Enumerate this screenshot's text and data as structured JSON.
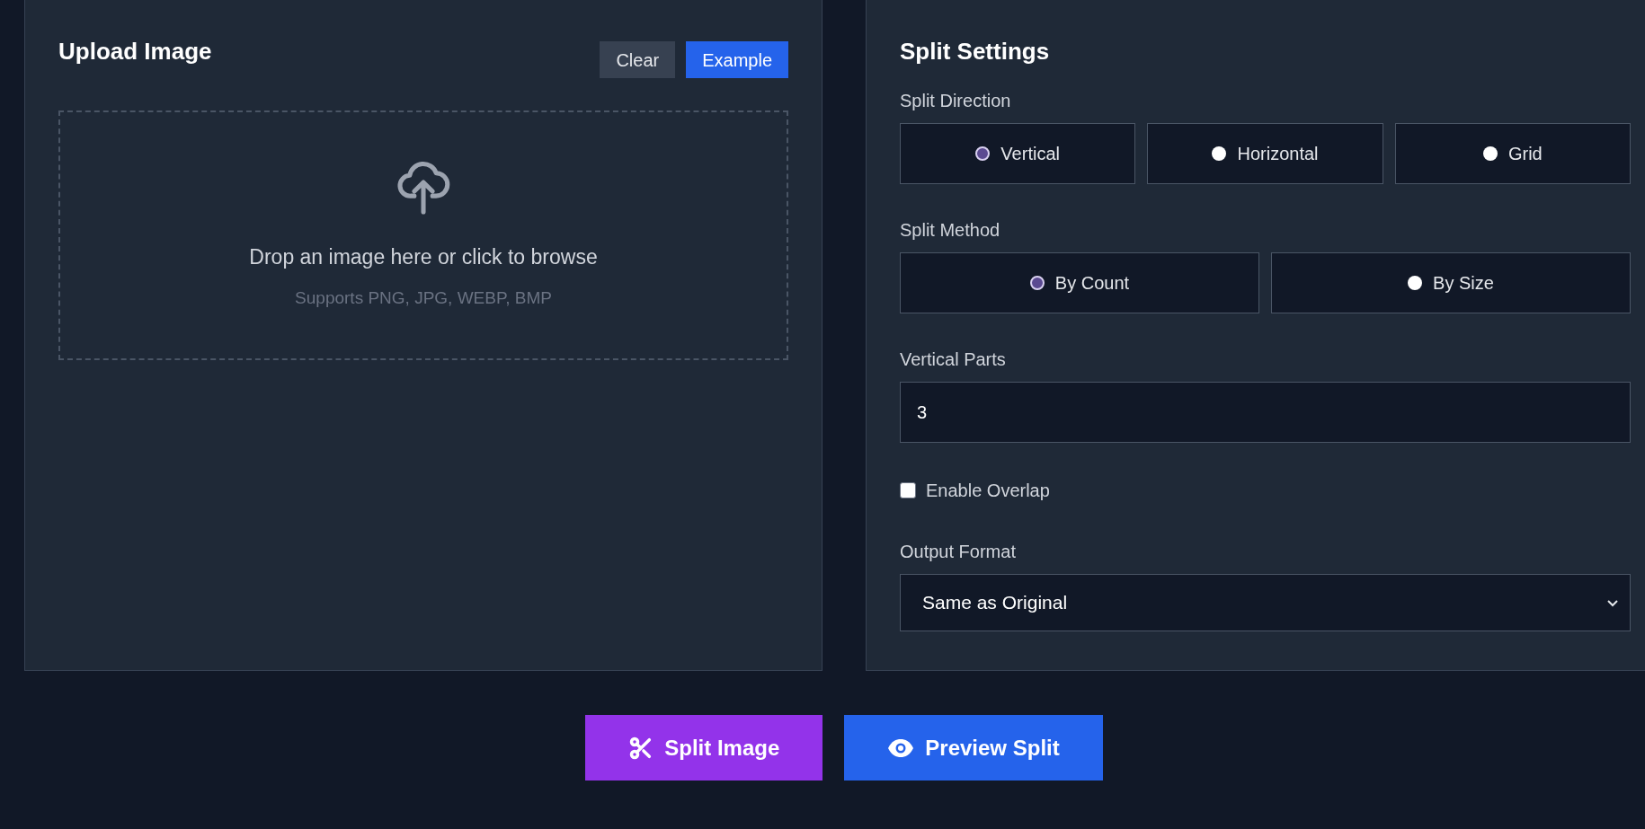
{
  "upload": {
    "title": "Upload Image",
    "buttons": [
      {
        "kind": "secondary",
        "label": "Clear"
      },
      {
        "kind": "primary",
        "label": "Example"
      }
    ],
    "dropzone": {
      "text": "Drop an image here or click to browse",
      "hint": "Supports PNG, JPG, WEBP, BMP"
    }
  },
  "settings": {
    "title": "Split Settings",
    "direction": {
      "label": "Split Direction",
      "options": [
        {
          "label": "Vertical",
          "selected": true
        },
        {
          "label": "Horizontal",
          "selected": false
        },
        {
          "label": "Grid",
          "selected": false
        }
      ]
    },
    "method": {
      "label": "Split Method",
      "options": [
        {
          "label": "By Count",
          "selected": true
        },
        {
          "label": "By Size",
          "selected": false
        }
      ]
    },
    "parts": {
      "label": "Vertical Parts",
      "value": "3"
    },
    "overlap": {
      "label": "Enable Overlap",
      "checked": false
    },
    "format": {
      "label": "Output Format",
      "value": "Same as Original"
    }
  },
  "actions": [
    {
      "kind": "scissors",
      "label": "Split Image",
      "color": "#9333ea"
    },
    {
      "kind": "eye",
      "label": "Preview Split",
      "color": "#2563eb"
    }
  ]
}
